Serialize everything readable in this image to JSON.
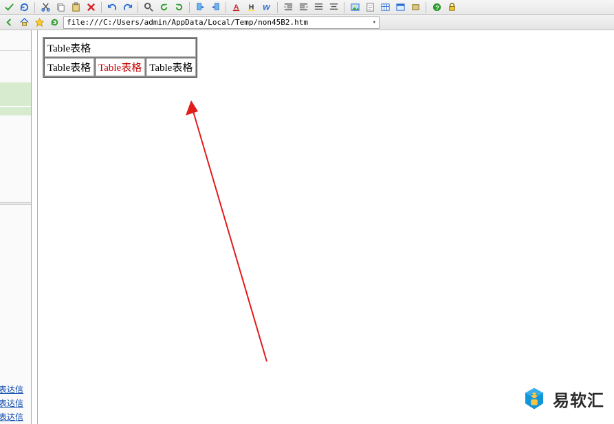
{
  "toolbar": {
    "icons": [
      "check-green-icon",
      "reload-blue-icon",
      "sep",
      "cut-icon",
      "copy-icon",
      "paste-icon",
      "delete-red-icon",
      "sep",
      "undo-icon",
      "redo-icon",
      "sep",
      "zoom-icon",
      "rotate-left-icon",
      "rotate-right-icon",
      "sep",
      "bookmark-next-icon",
      "bookmark-prev-icon",
      "sep",
      "font-color-icon",
      "highlight-icon",
      "text-w-icon",
      "sep",
      "indent-left-icon",
      "indent-right-icon",
      "outdent-icon",
      "align-icon",
      "sep",
      "image-icon",
      "doc-icon",
      "table-icon",
      "window-icon",
      "box-icon",
      "sep",
      "help-icon",
      "lock-icon"
    ]
  },
  "addressbar": {
    "icons_left": [
      "back-icon",
      "home-icon",
      "favorites-star-icon",
      "refresh-icon"
    ],
    "url": "file:///C:/Users/admin/AppData/Local/Temp/non45B2.htm"
  },
  "sidebar": {
    "links": [
      "表达信",
      "表达信",
      "表达信"
    ]
  },
  "table": {
    "row1": {
      "cell": "Table表格",
      "colspan": 3
    },
    "row2": [
      "Table表格",
      "Table表格",
      "Table表格"
    ],
    "highlight_index": 1
  },
  "watermark": {
    "text": "易软汇"
  },
  "colors": {
    "arrow": "#e21b1b",
    "link": "#0645ad",
    "sidebar_highlight": "#d7eccf",
    "watermark_blue": "#1296db",
    "watermark_yellow": "#f7c543"
  }
}
